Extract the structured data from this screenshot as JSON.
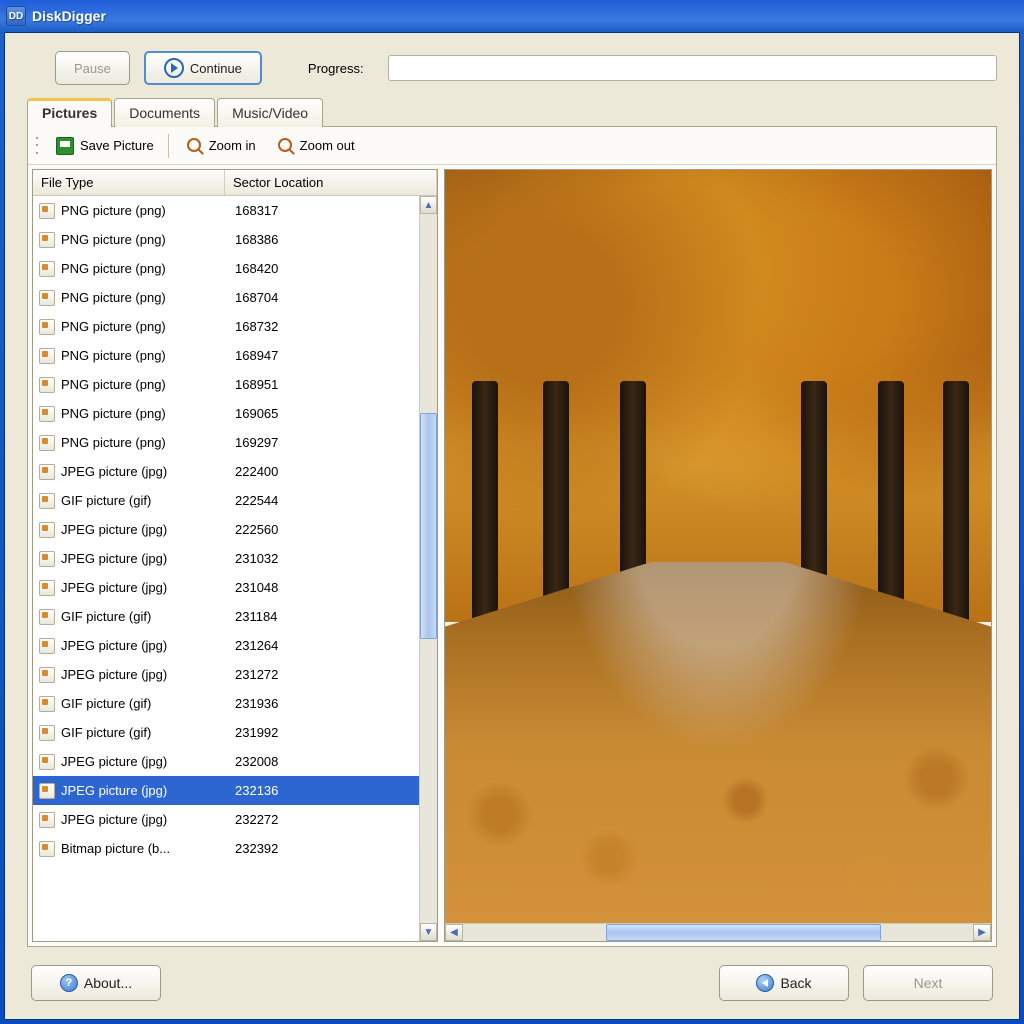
{
  "titlebar": {
    "icon_text": "DD",
    "title": "DiskDigger"
  },
  "controls": {
    "pause_label": "Pause",
    "continue_label": "Continue",
    "progress_label": "Progress:"
  },
  "tabs": [
    {
      "label": "Pictures",
      "active": true
    },
    {
      "label": "Documents",
      "active": false
    },
    {
      "label": "Music/Video",
      "active": false
    }
  ],
  "toolbar": {
    "save_label": "Save Picture",
    "zoom_in_label": "Zoom in",
    "zoom_out_label": "Zoom out"
  },
  "columns": {
    "type": "File Type",
    "sector": "Sector Location"
  },
  "rows": [
    {
      "type": "PNG picture (png)",
      "sector": "168317"
    },
    {
      "type": "PNG picture (png)",
      "sector": "168386"
    },
    {
      "type": "PNG picture (png)",
      "sector": "168420"
    },
    {
      "type": "PNG picture (png)",
      "sector": "168704"
    },
    {
      "type": "PNG picture (png)",
      "sector": "168732"
    },
    {
      "type": "PNG picture (png)",
      "sector": "168947"
    },
    {
      "type": "PNG picture (png)",
      "sector": "168951"
    },
    {
      "type": "PNG picture (png)",
      "sector": "169065"
    },
    {
      "type": "PNG picture (png)",
      "sector": "169297"
    },
    {
      "type": "JPEG picture (jpg)",
      "sector": "222400"
    },
    {
      "type": "GIF picture (gif)",
      "sector": "222544"
    },
    {
      "type": "JPEG picture (jpg)",
      "sector": "222560"
    },
    {
      "type": "JPEG picture (jpg)",
      "sector": "231032"
    },
    {
      "type": "JPEG picture (jpg)",
      "sector": "231048"
    },
    {
      "type": "GIF picture (gif)",
      "sector": "231184"
    },
    {
      "type": "JPEG picture (jpg)",
      "sector": "231264"
    },
    {
      "type": "JPEG picture (jpg)",
      "sector": "231272"
    },
    {
      "type": "GIF picture (gif)",
      "sector": "231936"
    },
    {
      "type": "GIF picture (gif)",
      "sector": "231992"
    },
    {
      "type": "JPEG picture (jpg)",
      "sector": "232008"
    },
    {
      "type": "JPEG picture (jpg)",
      "sector": "232136",
      "selected": true
    },
    {
      "type": "JPEG picture (jpg)",
      "sector": "232272"
    },
    {
      "type": "Bitmap picture (b...",
      "sector": "232392"
    }
  ],
  "footer": {
    "about_label": "About...",
    "back_label": "Back",
    "next_label": "Next"
  }
}
